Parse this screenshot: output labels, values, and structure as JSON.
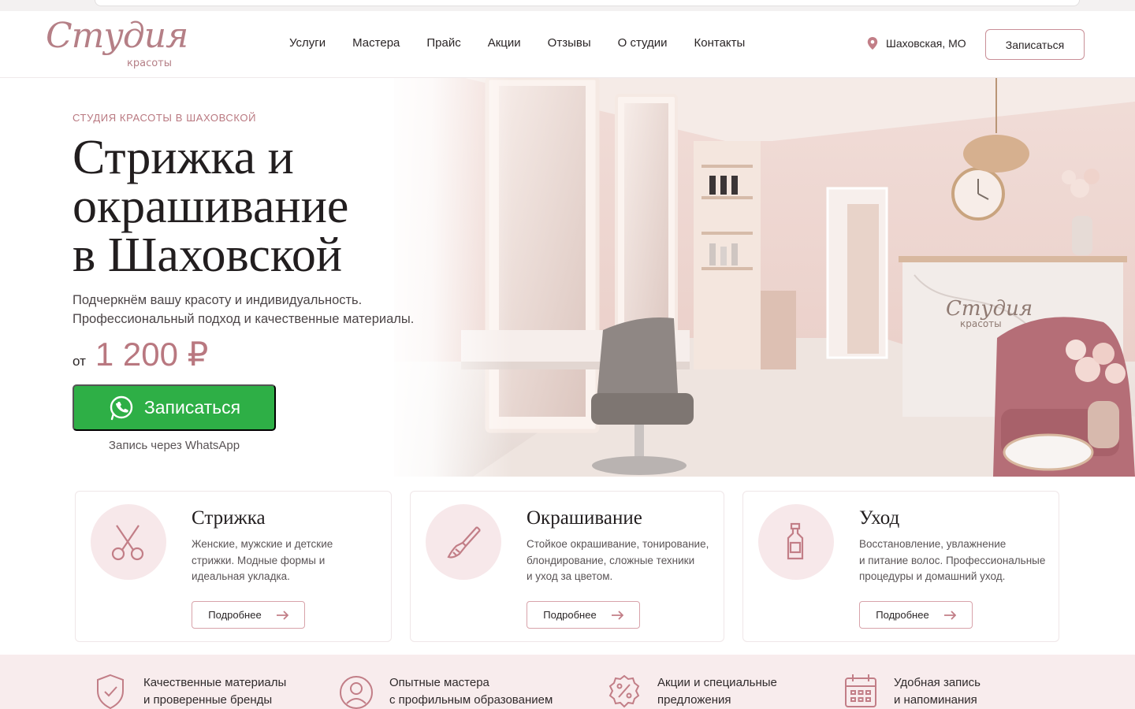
{
  "brand": {
    "name": "Студия",
    "sub": "красоты",
    "accent": "#b97880"
  },
  "nav": [
    "Услуги",
    "Мастера",
    "Прайс",
    "Акции",
    "Отзывы",
    "О студии",
    "Контакты"
  ],
  "header": {
    "location": "Шаховская, МО",
    "book_label": "Записаться"
  },
  "hero": {
    "eyebrow": "СТУДИЯ КРАСОТЫ В ШАХОВСКОЙ",
    "title_line1": "Стрижка и",
    "title_line2": "окрашивание",
    "title_line3": "в Шаховской",
    "lead_line1": "Подчеркнём вашу красоту и индивидуальность.",
    "lead_line2": "Профессиональный подход и качественные материалы.",
    "price_from": "от",
    "price_value": "1 200 ₽",
    "cta_label": "Записаться",
    "cta_note": "Запись через WhatsApp",
    "cta_color": "#2eaf46",
    "image_sign_line1": "Студия",
    "image_sign_line2": "красоты"
  },
  "services": [
    {
      "title": "Стрижка",
      "desc": [
        "Женские, мужские и детские",
        "стрижки. Модные формы и",
        "идеальная укладка."
      ],
      "more": "Подробнее",
      "icon": "scissors-icon"
    },
    {
      "title": "Окрашивание",
      "desc": [
        "Стойкое окрашивание, тонирование,",
        "блондирование, сложные техники",
        "и уход за цветом."
      ],
      "more": "Подробнее",
      "icon": "brush-icon"
    },
    {
      "title": "Уход",
      "desc": [
        "Восстановление, увлажнение",
        "и питание волос. Профессиональные",
        "процедуры и домашний уход."
      ],
      "more": "Подробнее",
      "icon": "bottle-icon"
    }
  ],
  "features": [
    {
      "line1": "Качественные материалы",
      "line2": "и проверенные бренды",
      "icon": "shield-check-icon"
    },
    {
      "line1": "Опытные мастера",
      "line2": "с профильным образованием",
      "icon": "user-icon"
    },
    {
      "line1": "Акции и специальные",
      "line2": "предложения",
      "icon": "percent-badge-icon"
    },
    {
      "line1": "Удобная запись",
      "line2": "и напоминания",
      "icon": "calendar-icon"
    }
  ]
}
